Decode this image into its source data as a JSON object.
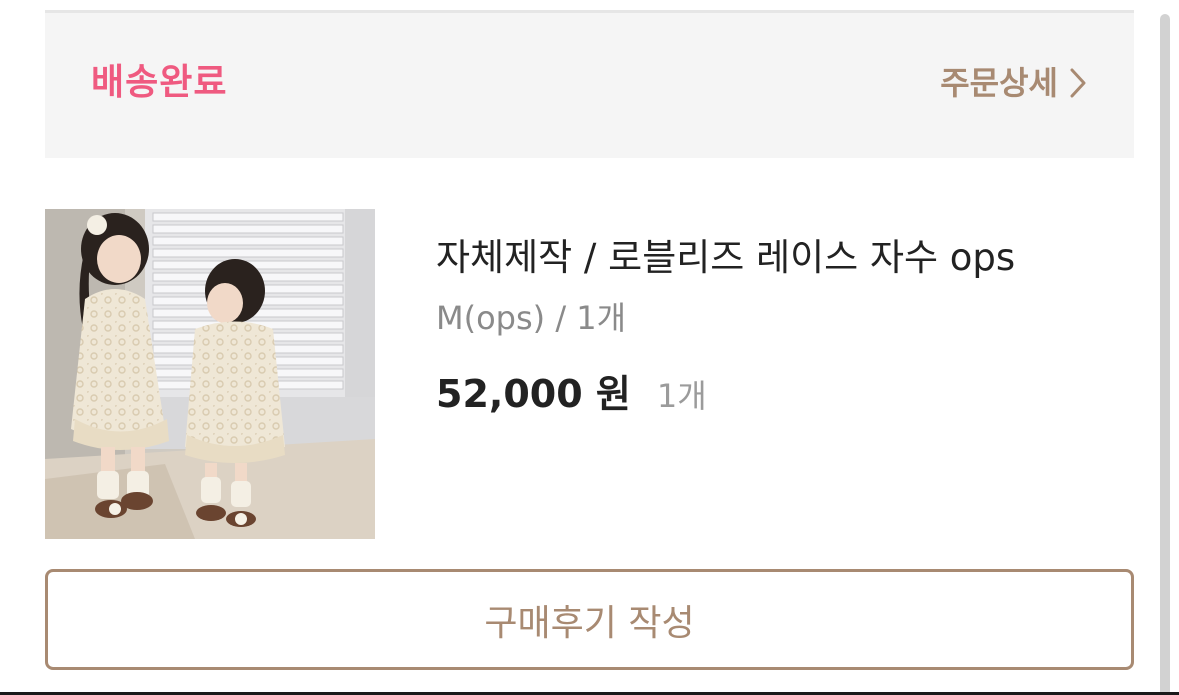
{
  "order": {
    "status_label": "배송완료",
    "detail_link_label": "주문상세",
    "detail_link_icon": "chevron-right-icon"
  },
  "product": {
    "name": "자체제작 / 로블리즈 레이스 자수 ops",
    "option": "M(ops) / 1개",
    "price": "52,000 원",
    "quantity": "1개",
    "thumbnail": "product-photo"
  },
  "actions": {
    "review_button_label": "구매후기 작성"
  },
  "colors": {
    "status_pink": "#ef5a80",
    "accent_brown": "#a88a72",
    "header_bg": "#f5f5f5"
  }
}
